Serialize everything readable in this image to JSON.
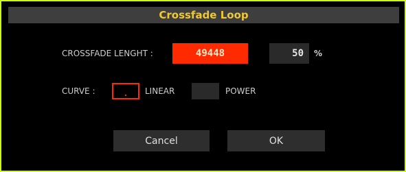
{
  "dialog": {
    "title": "Crossfade Loop"
  },
  "crossfade": {
    "length_label": "CROSSFADE LENGHT :",
    "length_value": "49448",
    "percent_value": "50",
    "percent_unit": "%"
  },
  "curve": {
    "label": "CURVE :",
    "options": [
      {
        "label": "LINEAR",
        "selected": true
      },
      {
        "label": "POWER",
        "selected": false
      }
    ]
  },
  "buttons": {
    "cancel": "Cancel",
    "ok": "OK"
  },
  "colors": {
    "border_accent": "#ccff00",
    "title_text": "#f0c830",
    "active_field": "#ff2a00",
    "field_bg": "#2a2a2a",
    "button_bg": "#2e2e2e"
  }
}
